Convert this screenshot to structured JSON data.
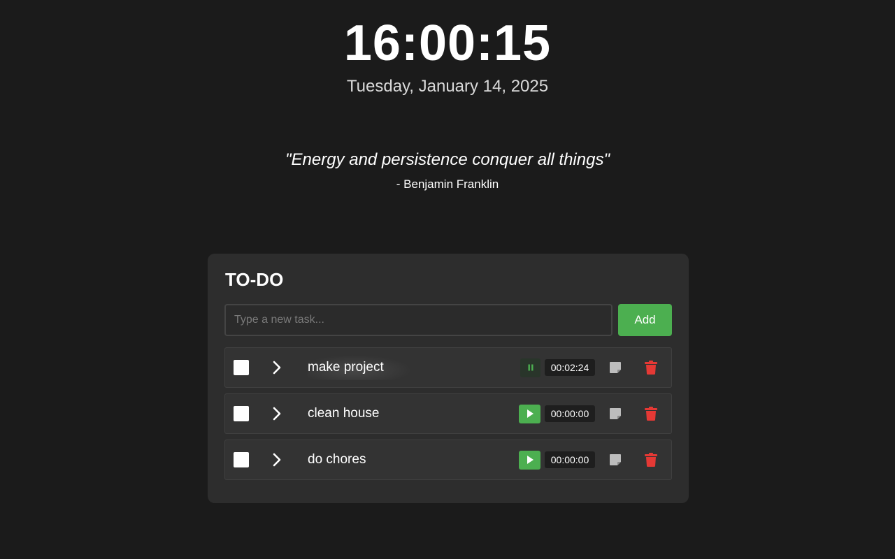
{
  "clock": {
    "time": "16:00:15",
    "date": "Tuesday, January 14, 2025"
  },
  "quote": {
    "text": "\"Energy and persistence conquer all things\"",
    "author": "- Benjamin Franklin"
  },
  "todo": {
    "title": "TO-DO",
    "input_placeholder": "Type a new task...",
    "input_value": "",
    "add_label": "Add",
    "tasks": [
      {
        "name": "make project",
        "checked": false,
        "timer": "00:02:24",
        "timer_state": "running",
        "timer_icon": "pause-icon"
      },
      {
        "name": "clean house",
        "checked": false,
        "timer": "00:00:00",
        "timer_state": "stopped",
        "timer_icon": "play-icon"
      },
      {
        "name": "do chores",
        "checked": false,
        "timer": "00:00:00",
        "timer_state": "stopped",
        "timer_icon": "play-icon"
      }
    ]
  },
  "colors": {
    "background": "#1b1b1b",
    "card": "#2d2d2d",
    "accent_green": "#4caf50",
    "delete_red": "#e53935",
    "note_gray": "#bdbdbd"
  }
}
